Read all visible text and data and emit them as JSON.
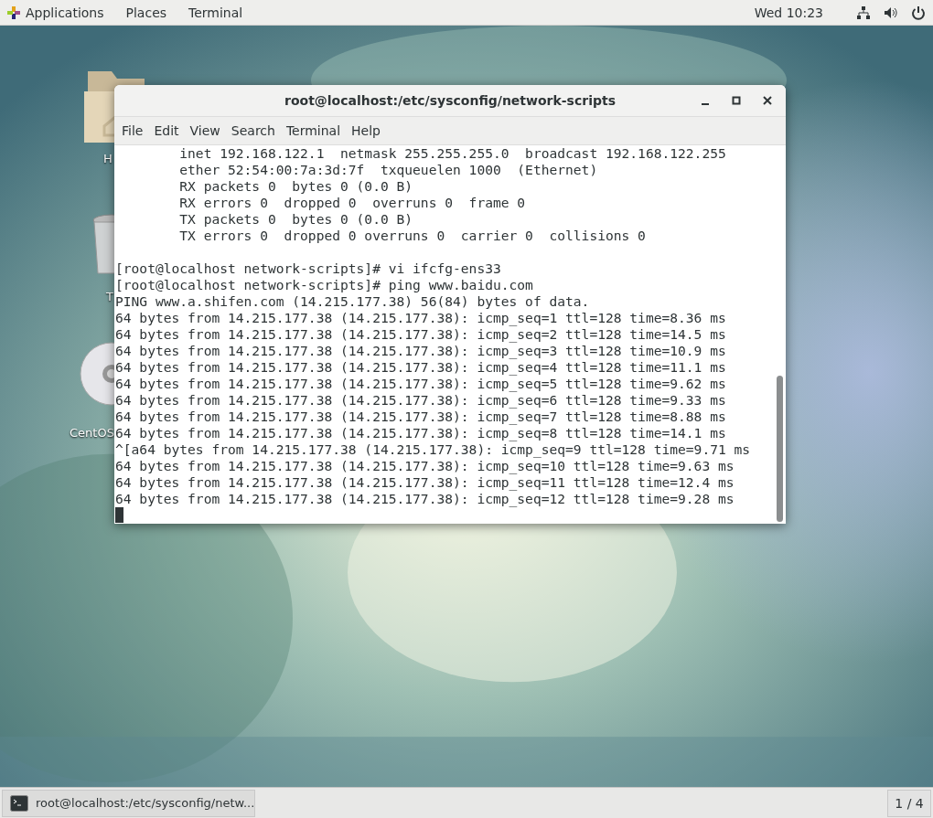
{
  "top_bar": {
    "menus": [
      {
        "label": "Applications",
        "kind": "logo"
      },
      {
        "label": "Places",
        "kind": "plain"
      },
      {
        "label": "Terminal",
        "kind": "plain"
      }
    ],
    "clock": "Wed 10:23"
  },
  "desktop": {
    "icons": [
      {
        "kind": "folder",
        "label": "H"
      },
      {
        "kind": "trash",
        "label": "T"
      },
      {
        "kind": "disc",
        "label": "CentOS"
      }
    ]
  },
  "window": {
    "title": "root@localhost:/etc/sysconfig/network-scripts",
    "menu": [
      "File",
      "Edit",
      "View",
      "Search",
      "Terminal",
      "Help"
    ],
    "terminal": {
      "sections": [
        [
          "        inet 192.168.122.1  netmask 255.255.255.0  broadcast 192.168.122.255",
          "        ether 52:54:00:7a:3d:7f  txqueuelen 1000  (Ethernet)",
          "        RX packets 0  bytes 0 (0.0 B)",
          "        RX errors 0  dropped 0  overruns 0  frame 0",
          "        TX packets 0  bytes 0 (0.0 B)",
          "        TX errors 0  dropped 0 overruns 0  carrier 0  collisions 0"
        ],
        [
          "[root@localhost network-scripts]# vi ifcfg-ens33",
          "[root@localhost network-scripts]# ping www.baidu.com",
          "PING www.a.shifen.com (14.215.177.38) 56(84) bytes of data.",
          "64 bytes from 14.215.177.38 (14.215.177.38): icmp_seq=1 ttl=128 time=8.36 ms",
          "64 bytes from 14.215.177.38 (14.215.177.38): icmp_seq=2 ttl=128 time=14.5 ms",
          "64 bytes from 14.215.177.38 (14.215.177.38): icmp_seq=3 ttl=128 time=10.9 ms",
          "64 bytes from 14.215.177.38 (14.215.177.38): icmp_seq=4 ttl=128 time=11.1 ms",
          "64 bytes from 14.215.177.38 (14.215.177.38): icmp_seq=5 ttl=128 time=9.62 ms",
          "64 bytes from 14.215.177.38 (14.215.177.38): icmp_seq=6 ttl=128 time=9.33 ms",
          "64 bytes from 14.215.177.38 (14.215.177.38): icmp_seq=7 ttl=128 time=8.88 ms",
          "64 bytes from 14.215.177.38 (14.215.177.38): icmp_seq=8 ttl=128 time=14.1 ms",
          "^[a64 bytes from 14.215.177.38 (14.215.177.38): icmp_seq=9 ttl=128 time=9.71 ms",
          "64 bytes from 14.215.177.38 (14.215.177.38): icmp_seq=10 ttl=128 time=9.63 ms",
          "64 bytes from 14.215.177.38 (14.215.177.38): icmp_seq=11 ttl=128 time=12.4 ms",
          "64 bytes from 14.215.177.38 (14.215.177.38): icmp_seq=12 ttl=128 time=9.28 ms"
        ]
      ],
      "cursor": true
    }
  },
  "taskbar": {
    "tasks": [
      {
        "label": "root@localhost:/etc/sysconfig/netw...",
        "selected": true
      }
    ],
    "workspace": "1 / 4"
  }
}
